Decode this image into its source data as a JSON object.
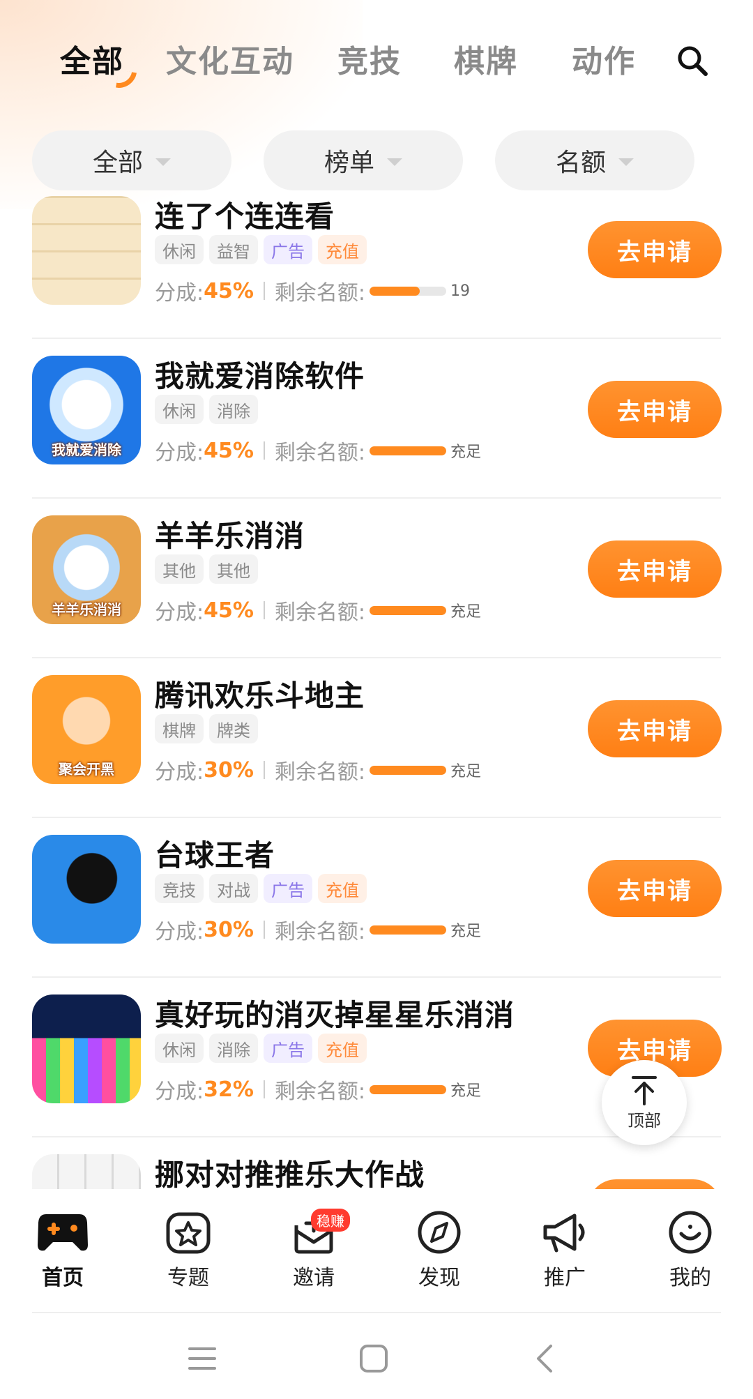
{
  "tabs": [
    {
      "label": "全部",
      "active": true
    },
    {
      "label": "文化互动"
    },
    {
      "label": "竞技"
    },
    {
      "label": "棋牌"
    },
    {
      "label": "动作"
    }
  ],
  "filters": [
    {
      "label": "全部"
    },
    {
      "label": "榜单"
    },
    {
      "label": "名额"
    }
  ],
  "list_labels": {
    "share_prefix": "分成:",
    "remaining_prefix": "剩余名额:",
    "apply_label": "去申请"
  },
  "games": [
    {
      "name": "连了个连连看",
      "tags": [
        "休闲",
        "益智",
        "广告",
        "充值"
      ],
      "share": "45%",
      "remaining": "19",
      "remaining_fill": 0.65,
      "icon_label": ""
    },
    {
      "name": "我就爱消除软件",
      "tags": [
        "休闲",
        "消除"
      ],
      "share": "45%",
      "remaining": "充足",
      "remaining_fill": 1.0,
      "icon_label": "我就爱消除"
    },
    {
      "name": "羊羊乐消消",
      "tags": [
        "其他",
        "其他"
      ],
      "share": "45%",
      "remaining": "充足",
      "remaining_fill": 1.0,
      "icon_label": "羊羊乐消消"
    },
    {
      "name": "腾讯欢乐斗地主",
      "tags": [
        "棋牌",
        "牌类"
      ],
      "share": "30%",
      "remaining": "充足",
      "remaining_fill": 1.0,
      "icon_label": "聚会开黑"
    },
    {
      "name": "台球王者",
      "tags": [
        "竞技",
        "对战",
        "广告",
        "充值"
      ],
      "share": "30%",
      "remaining": "充足",
      "remaining_fill": 1.0,
      "icon_label": ""
    },
    {
      "name": "真好玩的消灭掉星星乐消消",
      "tags": [
        "休闲",
        "消除",
        "广告",
        "充值"
      ],
      "share": "32%",
      "remaining": "充足",
      "remaining_fill": 1.0,
      "icon_label": ""
    },
    {
      "name": "挪对对推推乐大作战",
      "tags": [],
      "share": "",
      "remaining": "",
      "remaining_fill": 0,
      "icon_label": ""
    }
  ],
  "back_to_top": {
    "label": "顶部"
  },
  "bottom_nav": [
    {
      "label": "首页",
      "icon": "gamepad-icon",
      "active": true
    },
    {
      "label": "专题",
      "icon": "topic-icon"
    },
    {
      "label": "邀请",
      "icon": "invite-icon",
      "badge": "稳赚"
    },
    {
      "label": "发现",
      "icon": "compass-icon"
    },
    {
      "label": "推广",
      "icon": "megaphone-icon"
    },
    {
      "label": "我的",
      "icon": "smile-icon"
    }
  ],
  "colors": {
    "accent": "#ff8a1f",
    "ad_tag": "#8a76e8",
    "pay_tag": "#ff8a3a"
  }
}
